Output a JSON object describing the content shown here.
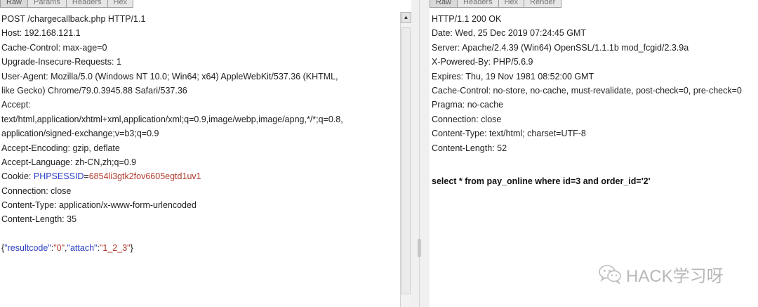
{
  "request": {
    "tabs": [
      "Raw",
      "Params",
      "Headers",
      "Hex"
    ],
    "lines": [
      "POST /chargecallback.php HTTP/1.1",
      "Host: 192.168.121.1",
      "Cache-Control: max-age=0",
      "Upgrade-Insecure-Requests: 1",
      "User-Agent: Mozilla/5.0 (Windows NT 10.0; Win64; x64) AppleWebKit/537.36 (KHTML,",
      "like Gecko) Chrome/79.0.3945.88 Safari/537.36",
      "Accept:",
      "text/html,application/xhtml+xml,application/xml;q=0.9,image/webp,image/apng,*/*;q=0.8,",
      "application/signed-exchange;v=b3;q=0.9",
      "Accept-Encoding: gzip, deflate",
      "Accept-Language: zh-CN,zh;q=0.9"
    ],
    "cookie": {
      "prefix": "Cookie: ",
      "name": "PHPSESSID",
      "eq": "=",
      "value": "6854li3gtk2fov6605egtd1uv1"
    },
    "lines_after": [
      "Connection: close",
      "Content-Type: application/x-www-form-urlencoded",
      "Content-Length: 35"
    ],
    "body": {
      "open": "{",
      "key1": "\"resultcode\"",
      "colon1": ":",
      "val1": "\"0\"",
      "comma": ",",
      "key2": "\"attach\"",
      "colon2": ":",
      "val2": "\"1_2_3\"",
      "close": "}"
    },
    "scroll_up_glyph": "▲"
  },
  "response": {
    "tabs": [
      "Raw",
      "Headers",
      "Hex",
      "Render"
    ],
    "lines": [
      "HTTP/1.1 200 OK",
      "Date: Wed, 25 Dec 2019 07:24:45 GMT",
      "Server: Apache/2.4.39 (Win64) OpenSSL/1.1.1b mod_fcgid/2.3.9a",
      "X-Powered-By: PHP/5.6.9",
      "Expires: Thu, 19 Nov 1981 08:52:00 GMT",
      "Cache-Control: no-store, no-cache, must-revalidate, post-check=0, pre-check=0",
      "Pragma: no-cache",
      "Connection: close",
      "Content-Type: text/html; charset=UTF-8",
      "Content-Length: 52"
    ],
    "body": "select * from pay_online where id=3 and order_id='2'"
  },
  "watermark": {
    "text": "HACK学习呀"
  }
}
